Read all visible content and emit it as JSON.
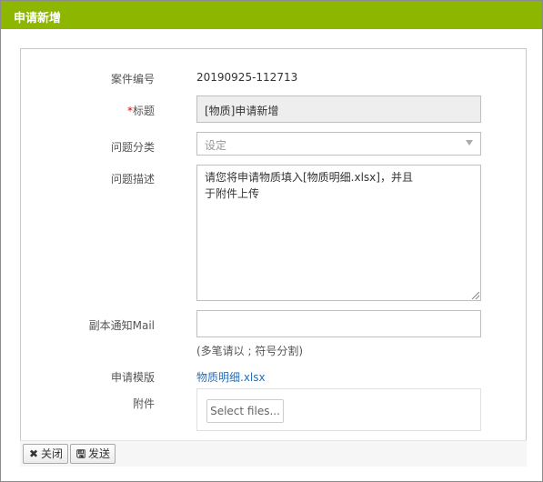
{
  "window": {
    "title": "申请新增"
  },
  "form": {
    "case_number": {
      "label": "案件编号",
      "value": "20190925-112713"
    },
    "title_field": {
      "required_mark": "*",
      "label": "标题",
      "value": "[物质]申请新增"
    },
    "category": {
      "label": "问题分类",
      "value": "设定"
    },
    "description": {
      "label": "问题描述",
      "value": "请您将申请物质填入[物质明细.xlsx]，并且于附件上传"
    },
    "cc_mail": {
      "label": "副本通知Mail",
      "value": "",
      "hint": "(多笔请以 ; 符号分割)"
    },
    "template": {
      "label": "申请模版",
      "link": "物质明细.xlsx"
    },
    "attachment": {
      "label": "附件",
      "button": "Select files..."
    }
  },
  "footer": {
    "close_label": "关闭",
    "send_label": "发送"
  },
  "colors": {
    "titlebar": "#8db600",
    "link": "#2a6fb5",
    "required": "#dd0000"
  }
}
